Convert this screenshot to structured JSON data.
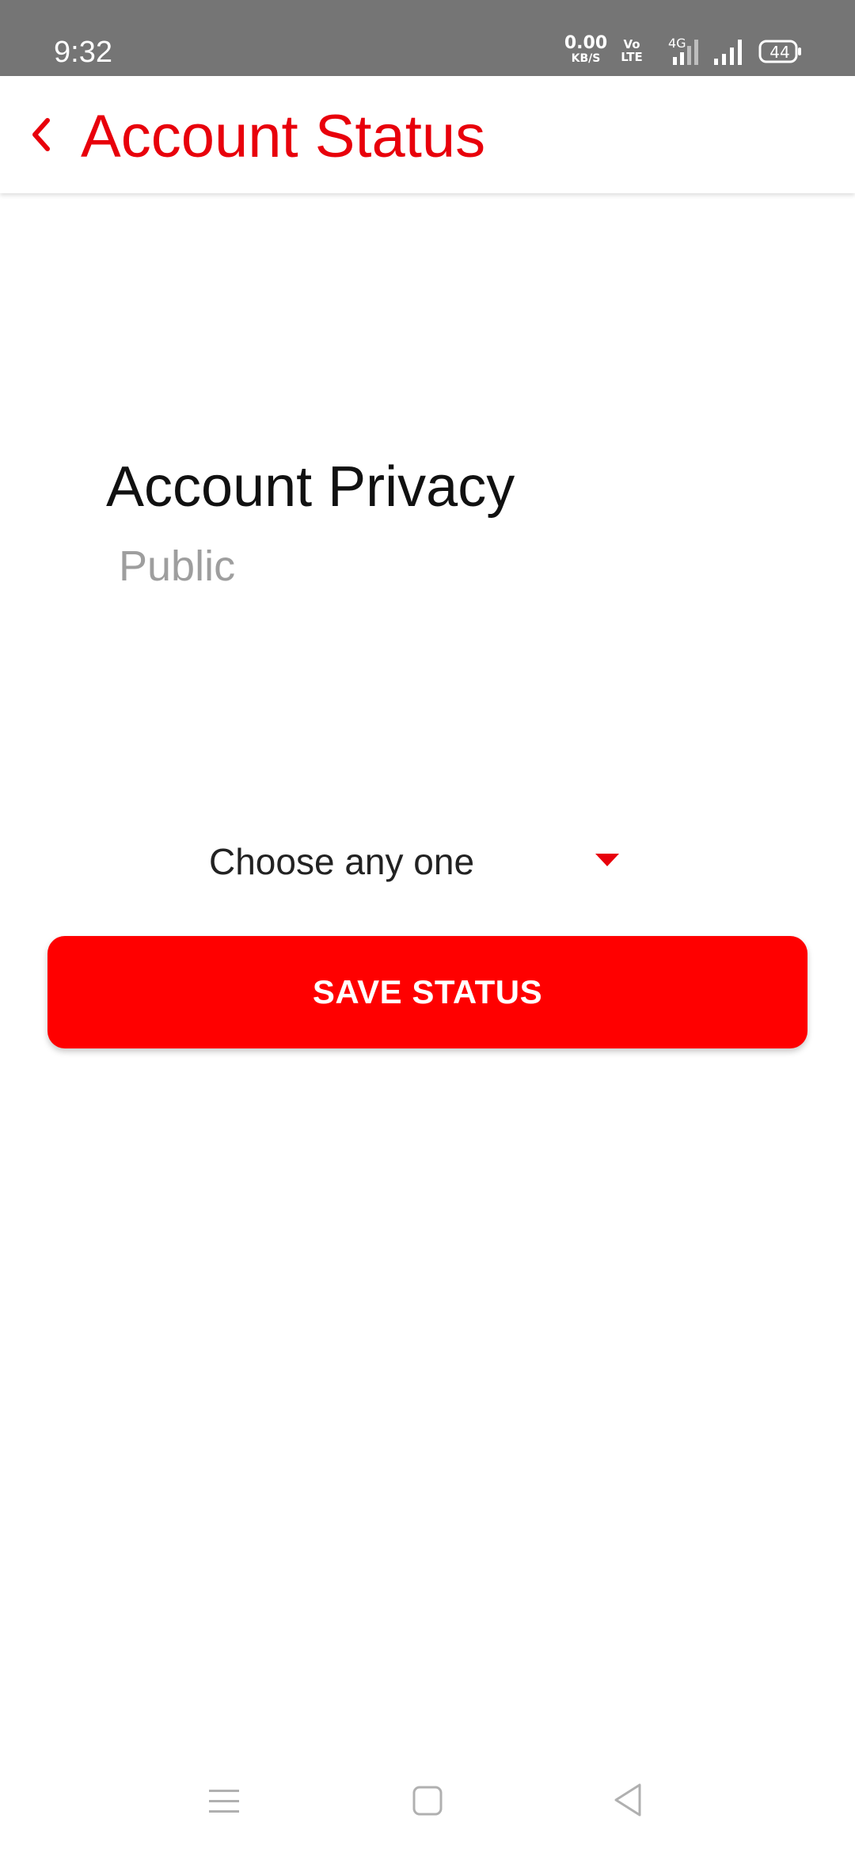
{
  "status_bar": {
    "time": "9:32",
    "net_speed_value": "0.00",
    "net_speed_unit": "KB/S",
    "volte_top": "Vo",
    "volte_bottom": "LTE",
    "network_type": "4G",
    "battery_level": "44"
  },
  "header": {
    "back_icon": "chevron-left-icon",
    "title": "Account Status"
  },
  "privacy": {
    "title": "Account Privacy",
    "current_value": "Public"
  },
  "dropdown": {
    "selected_label": "Choose any one",
    "arrow_icon": "caret-down-icon"
  },
  "actions": {
    "save_label": "SAVE STATUS"
  },
  "colors": {
    "accent": "#e8000b",
    "button": "#ff0000",
    "status_bar": "#757575",
    "muted_text": "#9e9e9e"
  },
  "nav_bar": {
    "icons": [
      "menu-icon",
      "home-square-icon",
      "back-triangle-icon"
    ]
  }
}
